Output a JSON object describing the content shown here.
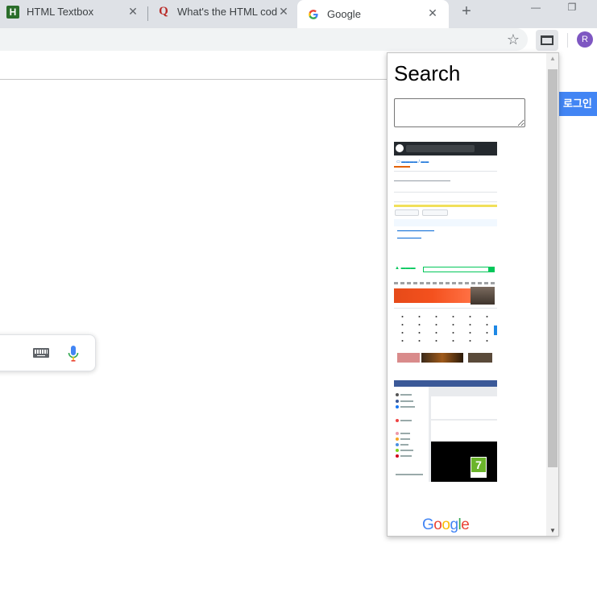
{
  "tabs": [
    {
      "title": "HTML Textbox",
      "favicon": "H"
    },
    {
      "title": "What's the HTML code",
      "favicon": "Q"
    },
    {
      "title": "Google",
      "favicon": "G",
      "active": true
    }
  ],
  "toolbar": {
    "avatar_letter": "R"
  },
  "page": {
    "login_label": "로그인"
  },
  "popup": {
    "title": "Search",
    "textarea_value": "",
    "thumbnails": [
      "github-repo-screenshot",
      "naver-homepage-screenshot",
      "facebook-feed-screenshot"
    ],
    "google_logo": [
      "G",
      "o",
      "o",
      "g",
      "l",
      "e"
    ]
  },
  "colors": {
    "tabstrip": "#dee1e6",
    "google_blue": "#4285f4",
    "google_red": "#ea4335",
    "google_yellow": "#fbbc05",
    "google_green": "#34a853",
    "avatar": "#7e57c2"
  }
}
